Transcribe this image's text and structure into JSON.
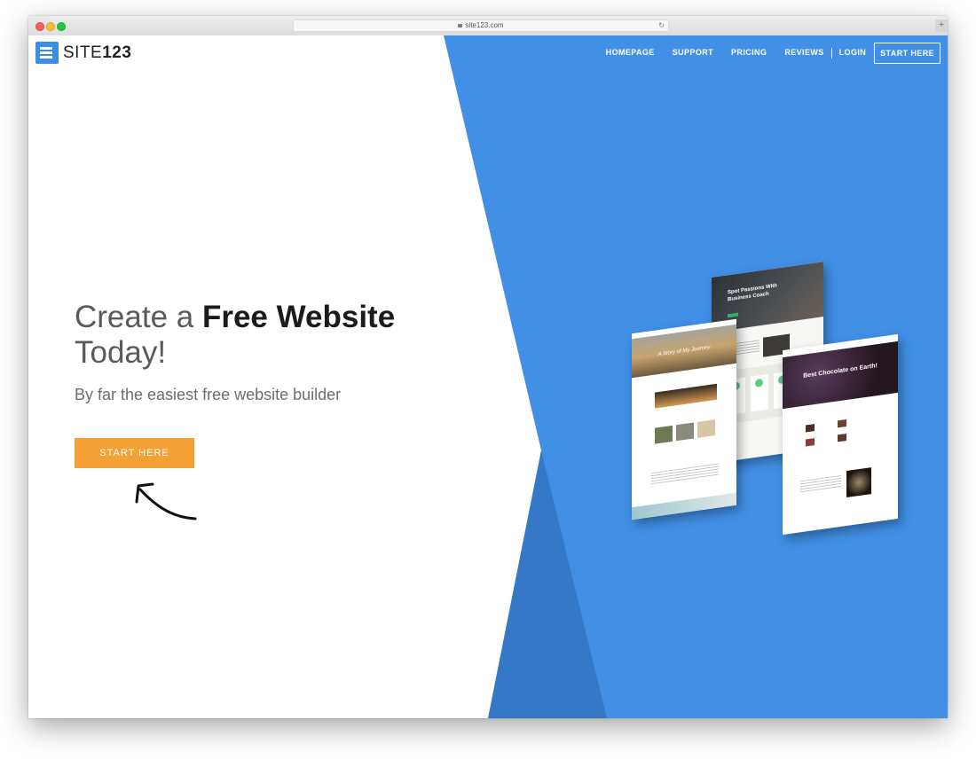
{
  "browser": {
    "url": "site123.com",
    "lock_icon": "lock-icon",
    "reload_icon": "reload-icon",
    "newtab_label": "+"
  },
  "brand": {
    "name_light": "SITE",
    "name_bold": "123",
    "icon": "menu-lines-logo-icon",
    "color": "#3a8ee6"
  },
  "nav": {
    "items": [
      "HOMEPAGE",
      "SUPPORT",
      "PRICING",
      "REVIEWS",
      "LOGIN"
    ],
    "cta": "START HERE"
  },
  "hero": {
    "title_prefix": "Create a ",
    "title_bold": "Free Website",
    "title_suffix": "Today!",
    "subtitle": "By far the easiest free website builder",
    "button_label": "START HERE",
    "button_color": "#f3a034"
  },
  "colors": {
    "blue": "#4190e6",
    "blue_dark": "#3678c8",
    "white": "#ffffff"
  },
  "previews": {
    "coach_headline": "Spot Passions With Business Coach",
    "journey_headline": "A Story of My Journey",
    "chocolate_headline": "Best Chocolate on Earth!"
  }
}
